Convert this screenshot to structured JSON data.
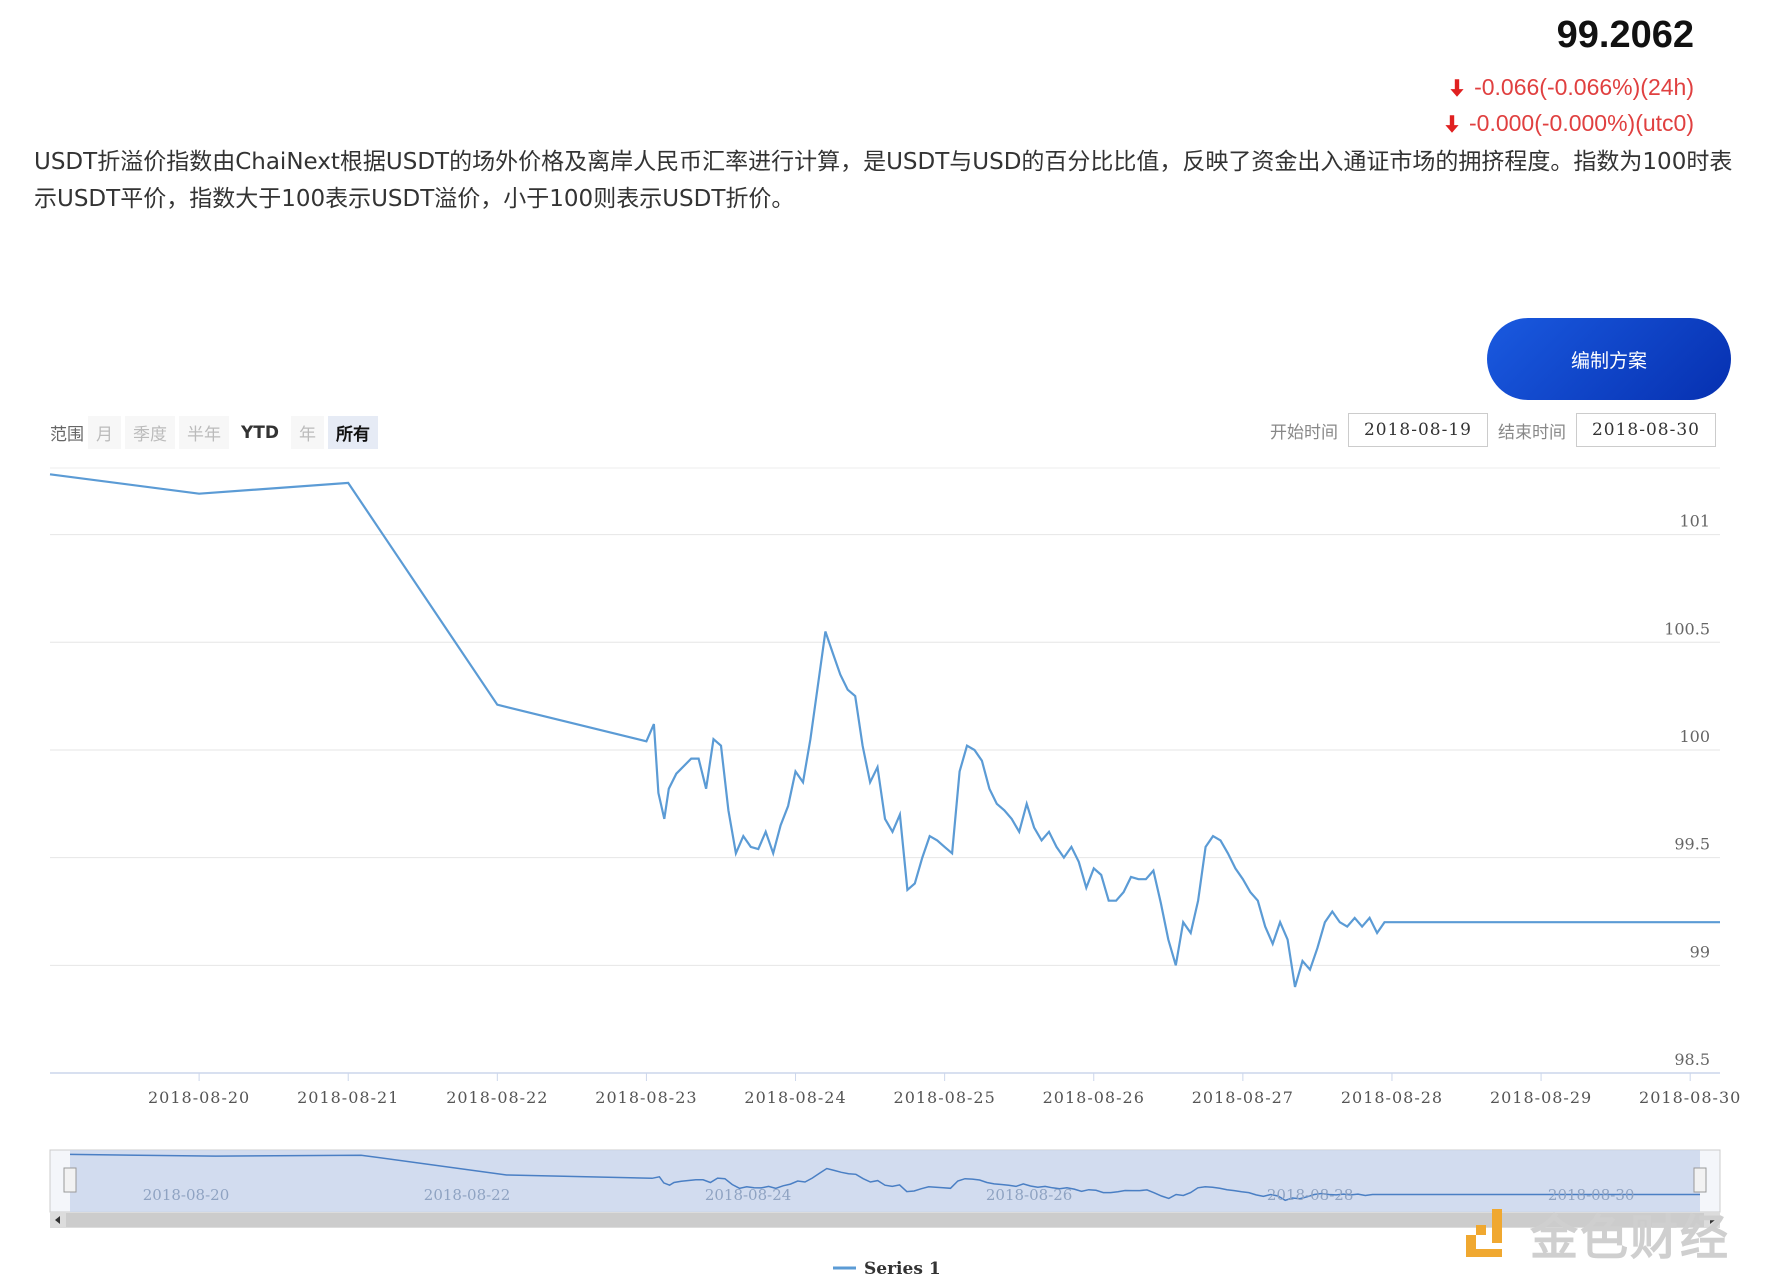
{
  "header": {
    "price": "99.2062",
    "change_24h": "-0.066(-0.066%)(24h)",
    "change_utc0": "-0.000(-0.000%)(utc0)"
  },
  "description": "USDT折溢价指数由ChaiNext根据USDT的场外价格及离岸人民币汇率进行计算，是USDT与USD的百分比比值，反映了资金出入通证市场的拥挤程度。指数为100时表示USDT平价，指数大于100表示USDT溢价，小于100则表示USDT折价。",
  "toolbar": {
    "plan_button": "编制方案",
    "range_label": "范围",
    "range_options": [
      "月",
      "季度",
      "半年",
      "YTD",
      "年",
      "所有"
    ],
    "start_label": "开始时间",
    "start_value": "2018-08-19",
    "end_label": "结束时间",
    "end_value": "2018-08-30"
  },
  "colors": {
    "line": "#5b9bd5",
    "grid": "#e6e6e6",
    "accent": "#0a3fc8",
    "down": "#e02020"
  },
  "watermark": {
    "text": "金色财经"
  },
  "chart_data": {
    "type": "line",
    "x_start": "2018-08-19 08:00",
    "x_end": "2018-08-30 12:00",
    "ylim": [
      98.5,
      101.3
    ],
    "yticks": [
      98.5,
      99,
      99.5,
      100,
      100.5,
      101
    ],
    "ytick_labels": [
      "98.5",
      "99",
      "99.5",
      "100",
      "100.5",
      "101"
    ],
    "xtick_labels": [
      "2018-08-20",
      "2018-08-21",
      "2018-08-22",
      "2018-08-23",
      "2018-08-24",
      "2018-08-25",
      "2018-08-26",
      "2018-08-27",
      "2018-08-28",
      "2018-08-29",
      "2018-08-30"
    ],
    "navigator_labels": [
      "2018-08-20",
      "2018-08-22",
      "2018-08-24",
      "2018-08-26",
      "2018-08-28",
      "2018-08-30"
    ],
    "legend": "bottom-center",
    "grid": true,
    "series": [
      {
        "name": "Series 1",
        "x_days": [
          0,
          1.0,
          2.0,
          3.0,
          4.0,
          4.05,
          4.08,
          4.12,
          4.15,
          4.2,
          4.3,
          4.35,
          4.4,
          4.45,
          4.5,
          4.55,
          4.6,
          4.65,
          4.7,
          4.75,
          4.8,
          4.85,
          4.9,
          4.95,
          5.0,
          5.05,
          5.1,
          5.15,
          5.2,
          5.25,
          5.3,
          5.35,
          5.4,
          5.45,
          5.5,
          5.55,
          5.6,
          5.65,
          5.7,
          5.75,
          5.8,
          5.85,
          5.9,
          5.95,
          6.0,
          6.05,
          6.1,
          6.15,
          6.2,
          6.25,
          6.3,
          6.35,
          6.4,
          6.45,
          6.5,
          6.55,
          6.6,
          6.65,
          6.7,
          6.75,
          6.8,
          6.85,
          6.9,
          6.95,
          7.0,
          7.05,
          7.1,
          7.15,
          7.2,
          7.25,
          7.3,
          7.35,
          7.4,
          7.45,
          7.5,
          7.55,
          7.6,
          7.65,
          7.7,
          7.75,
          7.8,
          7.85,
          7.9,
          7.95,
          8.0,
          8.05,
          8.1,
          8.15,
          8.2,
          8.25,
          8.3,
          8.35,
          8.4,
          8.45,
          8.5,
          8.55,
          8.6,
          8.65,
          8.7,
          8.75,
          8.8,
          8.85,
          8.9,
          8.95,
          9.0,
          9.05,
          9.1,
          9.15,
          9.2,
          9.25,
          9.3,
          9.35,
          9.4,
          9.45,
          9.5,
          9.55,
          9.6,
          9.65,
          9.7,
          9.75,
          9.8,
          9.85,
          9.9,
          9.95,
          10.0,
          10.05,
          10.1,
          10.15,
          10.2,
          10.25,
          10.3,
          10.35,
          10.4,
          10.45,
          10.5,
          10.55,
          10.6,
          10.65,
          10.7,
          10.75,
          10.8,
          10.85,
          10.9,
          10.95,
          11.0,
          11.05,
          11.1,
          11.15,
          11.2
        ],
        "values": [
          101.28,
          101.19,
          101.24,
          100.21,
          100.04,
          100.12,
          99.8,
          99.68,
          99.82,
          99.89,
          99.96,
          99.96,
          99.82,
          100.05,
          100.02,
          99.72,
          99.52,
          99.6,
          99.55,
          99.54,
          99.62,
          99.52,
          99.65,
          99.74,
          99.9,
          99.85,
          100.05,
          100.3,
          100.55,
          100.45,
          100.35,
          100.28,
          100.25,
          100.02,
          99.85,
          99.92,
          99.68,
          99.62,
          99.7,
          99.35,
          99.38,
          99.5,
          99.6,
          99.58,
          99.55,
          99.52,
          99.9,
          100.02,
          100.0,
          99.95,
          99.82,
          99.75,
          99.72,
          99.68,
          99.62,
          99.75,
          99.64,
          99.58,
          99.62,
          99.55,
          99.5,
          99.55,
          99.48,
          99.36,
          99.45,
          99.42,
          99.3,
          99.3,
          99.34,
          99.41,
          99.4,
          99.4,
          99.44,
          99.29,
          99.12,
          99.0,
          99.2,
          99.15,
          99.3,
          99.55,
          99.6,
          99.58,
          99.52,
          99.45,
          99.4,
          99.34,
          99.3,
          99.18,
          99.1,
          99.2,
          99.12,
          98.9,
          99.02,
          98.98,
          99.08,
          99.2,
          99.25,
          99.2,
          99.18,
          99.22,
          99.18,
          99.22,
          99.15,
          99.2,
          99.2,
          99.2,
          99.2,
          99.2,
          99.2,
          99.2,
          99.2,
          99.2,
          99.2,
          99.2,
          99.2,
          99.2,
          99.2,
          99.2,
          99.2,
          99.2,
          99.2,
          99.2,
          99.2,
          99.2,
          99.2,
          99.2,
          99.2,
          99.2,
          99.2,
          99.2,
          99.2,
          99.2,
          99.2,
          99.2,
          99.2,
          99.2,
          99.2,
          99.2,
          99.2,
          99.2,
          99.2,
          99.2,
          99.2,
          99.2,
          99.2,
          99.2,
          99.2,
          99.2,
          99.2
        ]
      }
    ]
  }
}
